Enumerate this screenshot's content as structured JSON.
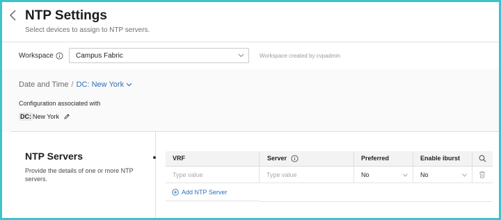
{
  "header": {
    "title": "NTP Settings",
    "subtitle": "Select devices to assign to NTP servers."
  },
  "workspace": {
    "label": "Workspace",
    "selected": "Campus Fabric",
    "meta": "Workspace created by cvpadmin"
  },
  "context": {
    "breadcrumb_root": "Date and Time",
    "breadcrumb_sep": "/",
    "breadcrumb_current": "DC: New York",
    "config_label": "Configuration associated with",
    "dc_tag": "DC:",
    "dc_value": "New York"
  },
  "ntp": {
    "title": "NTP Servers",
    "description": "Provide the details of one or more NTP servers.",
    "columns": [
      "VRF",
      "Server",
      "Preferred",
      "Enable iburst"
    ],
    "row": {
      "vrf_placeholder": "Type value",
      "server_placeholder": "Type value",
      "preferred": "No",
      "iburst": "No"
    },
    "add_label": "Add NTP Server"
  },
  "colors": {
    "accent": "#2f6fb7",
    "frame": "#3ec3cc"
  }
}
